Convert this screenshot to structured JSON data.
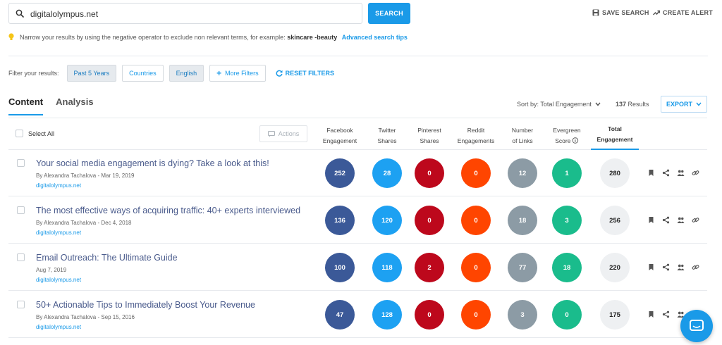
{
  "search": {
    "query": "digitalolympus.net",
    "button_label": "SEARCH",
    "save_label": "SAVE SEARCH",
    "alert_label": "CREATE ALERT"
  },
  "tip": {
    "text": "Narrow your results by using the negative operator to exclude non relevant terms, for example:",
    "example": "skincare -beauty",
    "link": "Advanced search tips"
  },
  "filters": {
    "label": "Filter your results:",
    "items": [
      {
        "label": "Past 5 Years",
        "active": true
      },
      {
        "label": "Countries",
        "active": false
      },
      {
        "label": "English",
        "active": true
      },
      {
        "label": "More Filters",
        "active": false
      }
    ],
    "reset_label": "RESET FILTERS"
  },
  "tabs": [
    {
      "label": "Content",
      "active": true
    },
    {
      "label": "Analysis",
      "active": false
    }
  ],
  "sort": {
    "label": "Sort by: Total Engagement",
    "count": "137",
    "results_label": "Results",
    "export_label": "EXPORT"
  },
  "table": {
    "select_all": "Select All",
    "actions_label": "Actions",
    "columns": [
      {
        "key": "facebook",
        "line1": "Facebook",
        "line2": "Engagement",
        "color": "#3b5998"
      },
      {
        "key": "twitter",
        "line1": "Twitter",
        "line2": "Shares",
        "color": "#1da1f2"
      },
      {
        "key": "pinterest",
        "line1": "Pinterest",
        "line2": "Shares",
        "color": "#bd081c"
      },
      {
        "key": "reddit",
        "line1": "Reddit",
        "line2": "Engagements",
        "color": "#ff4500"
      },
      {
        "key": "links",
        "line1": "Number",
        "line2": "of Links",
        "color": "#8c9ba5"
      },
      {
        "key": "evergreen",
        "line1": "Evergreen",
        "line2": "Score",
        "color": "#1abc8c"
      },
      {
        "key": "total",
        "line1": "Total",
        "line2": "Engagement",
        "color": "#eef0f2"
      }
    ],
    "rows": [
      {
        "title": "Your social media engagement is dying? Take a look at this!",
        "meta": "By Alexandra Tachalova - Mar 19, 2019",
        "domain": "digitalolympus.net",
        "values": [
          "252",
          "28",
          "0",
          "0",
          "12",
          "1",
          "280"
        ]
      },
      {
        "title": "The most effective ways of acquiring traffic: 40+ experts interviewed",
        "meta": "By Alexandra Tachalova - Dec 4, 2018",
        "domain": "digitalolympus.net",
        "values": [
          "136",
          "120",
          "0",
          "0",
          "18",
          "3",
          "256"
        ]
      },
      {
        "title": "Email Outreach: The Ultimate Guide",
        "meta": "Aug 7, 2019",
        "domain": "digitalolympus.net",
        "values": [
          "100",
          "118",
          "2",
          "0",
          "77",
          "18",
          "220"
        ]
      },
      {
        "title": "50+ Actionable Tips to Immediately Boost Your Revenue",
        "meta": "By Alexandra Tachalova - Sep 15, 2016",
        "domain": "digitalolympus.net",
        "values": [
          "47",
          "128",
          "0",
          "0",
          "3",
          "0",
          "175"
        ]
      }
    ]
  }
}
